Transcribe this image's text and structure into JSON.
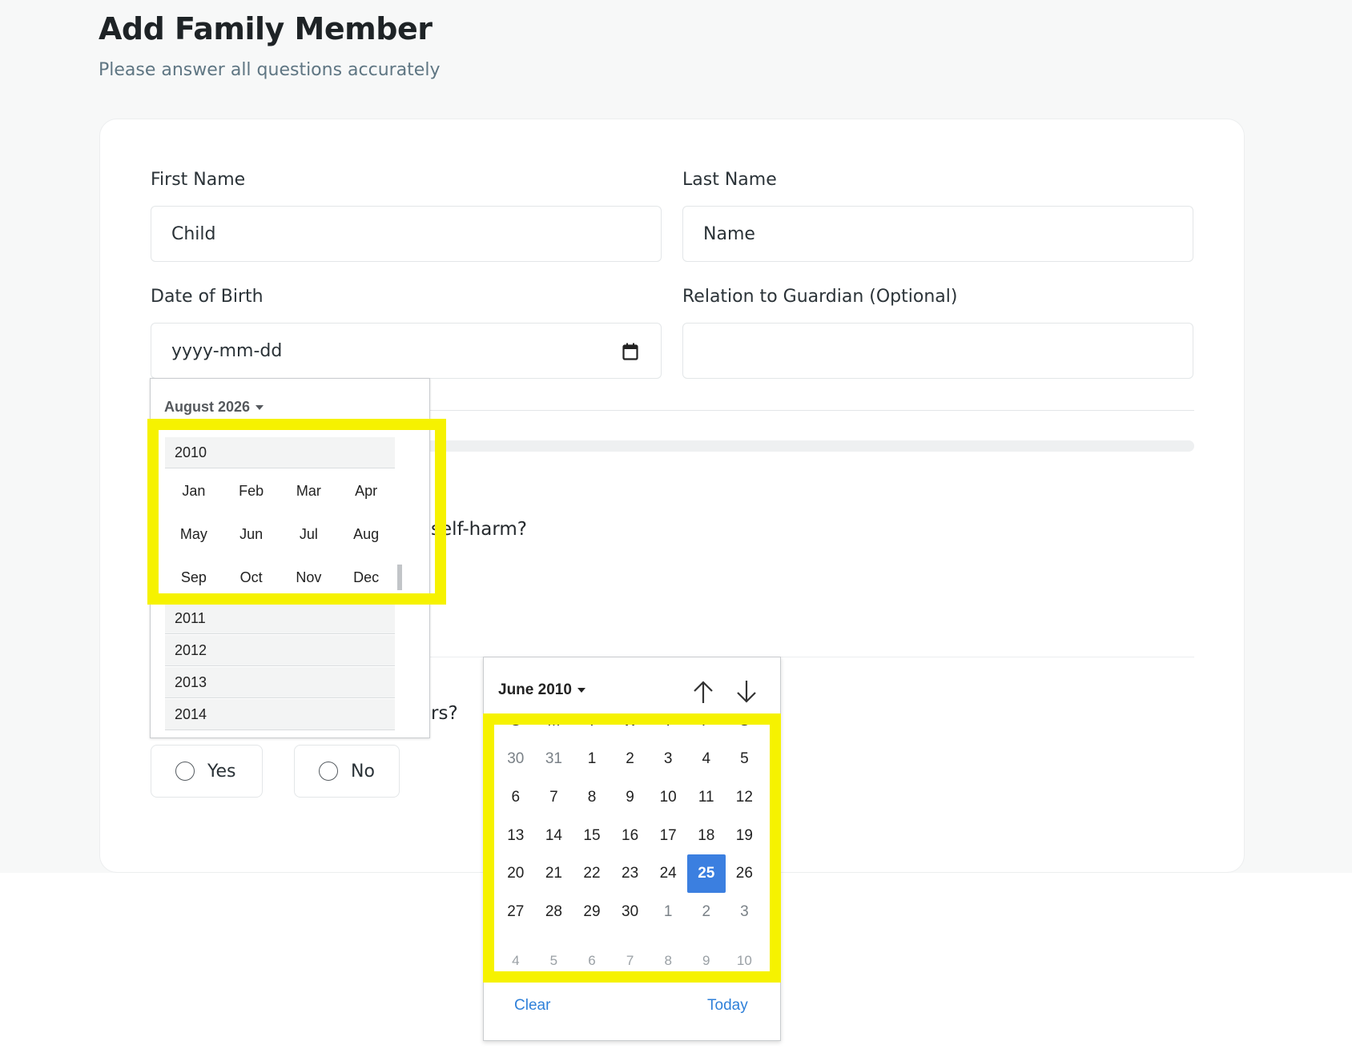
{
  "page": {
    "title": "Add Family Member",
    "subtitle": "Please answer all questions accurately"
  },
  "form": {
    "first_name": {
      "label": "First Name",
      "value": "Child"
    },
    "last_name": {
      "label": "Last Name",
      "value": "Name"
    },
    "dob": {
      "label": "Date of Birth",
      "value": "yyyy-mm-dd"
    },
    "relation": {
      "label": "Relation to Guardian (Optional)",
      "value": ""
    },
    "question1_fragment": "self-harm?",
    "question2_fragment": "rs?",
    "options": {
      "yes": "Yes",
      "no": "No"
    }
  },
  "month_picker": {
    "header": "August 2026",
    "selected_year": "2010",
    "months": [
      "Jan",
      "Feb",
      "Mar",
      "Apr",
      "May",
      "Jun",
      "Jul",
      "Aug",
      "Sep",
      "Oct",
      "Nov",
      "Dec"
    ],
    "other_years": [
      "2011",
      "2012",
      "2013",
      "2014"
    ]
  },
  "date_picker": {
    "header": "June 2010",
    "weekdays": [
      "S",
      "M",
      "T",
      "W",
      "T",
      "F",
      "S"
    ],
    "weeks": [
      [
        {
          "d": "30",
          "m": true
        },
        {
          "d": "31",
          "m": true
        },
        {
          "d": "1"
        },
        {
          "d": "2"
        },
        {
          "d": "3"
        },
        {
          "d": "4"
        },
        {
          "d": "5"
        }
      ],
      [
        {
          "d": "6"
        },
        {
          "d": "7"
        },
        {
          "d": "8"
        },
        {
          "d": "9"
        },
        {
          "d": "10"
        },
        {
          "d": "11"
        },
        {
          "d": "12"
        }
      ],
      [
        {
          "d": "13"
        },
        {
          "d": "14"
        },
        {
          "d": "15"
        },
        {
          "d": "16"
        },
        {
          "d": "17"
        },
        {
          "d": "18"
        },
        {
          "d": "19"
        }
      ],
      [
        {
          "d": "20"
        },
        {
          "d": "21"
        },
        {
          "d": "22"
        },
        {
          "d": "23"
        },
        {
          "d": "24"
        },
        {
          "d": "25",
          "s": true
        },
        {
          "d": "26"
        }
      ],
      [
        {
          "d": "27"
        },
        {
          "d": "28"
        },
        {
          "d": "29"
        },
        {
          "d": "30"
        },
        {
          "d": "1",
          "m": true
        },
        {
          "d": "2",
          "m": true
        },
        {
          "d": "3",
          "m": true
        }
      ],
      [
        {
          "d": "4",
          "p": true
        },
        {
          "d": "5",
          "p": true
        },
        {
          "d": "6",
          "p": true
        },
        {
          "d": "7",
          "p": true
        },
        {
          "d": "8",
          "p": true
        },
        {
          "d": "9",
          "p": true
        },
        {
          "d": "10",
          "p": true
        }
      ]
    ],
    "clear_label": "Clear",
    "today_label": "Today"
  },
  "colors": {
    "highlight": "#f6f200",
    "selected_day": "#3b7fe0",
    "link": "#2f80d9"
  }
}
